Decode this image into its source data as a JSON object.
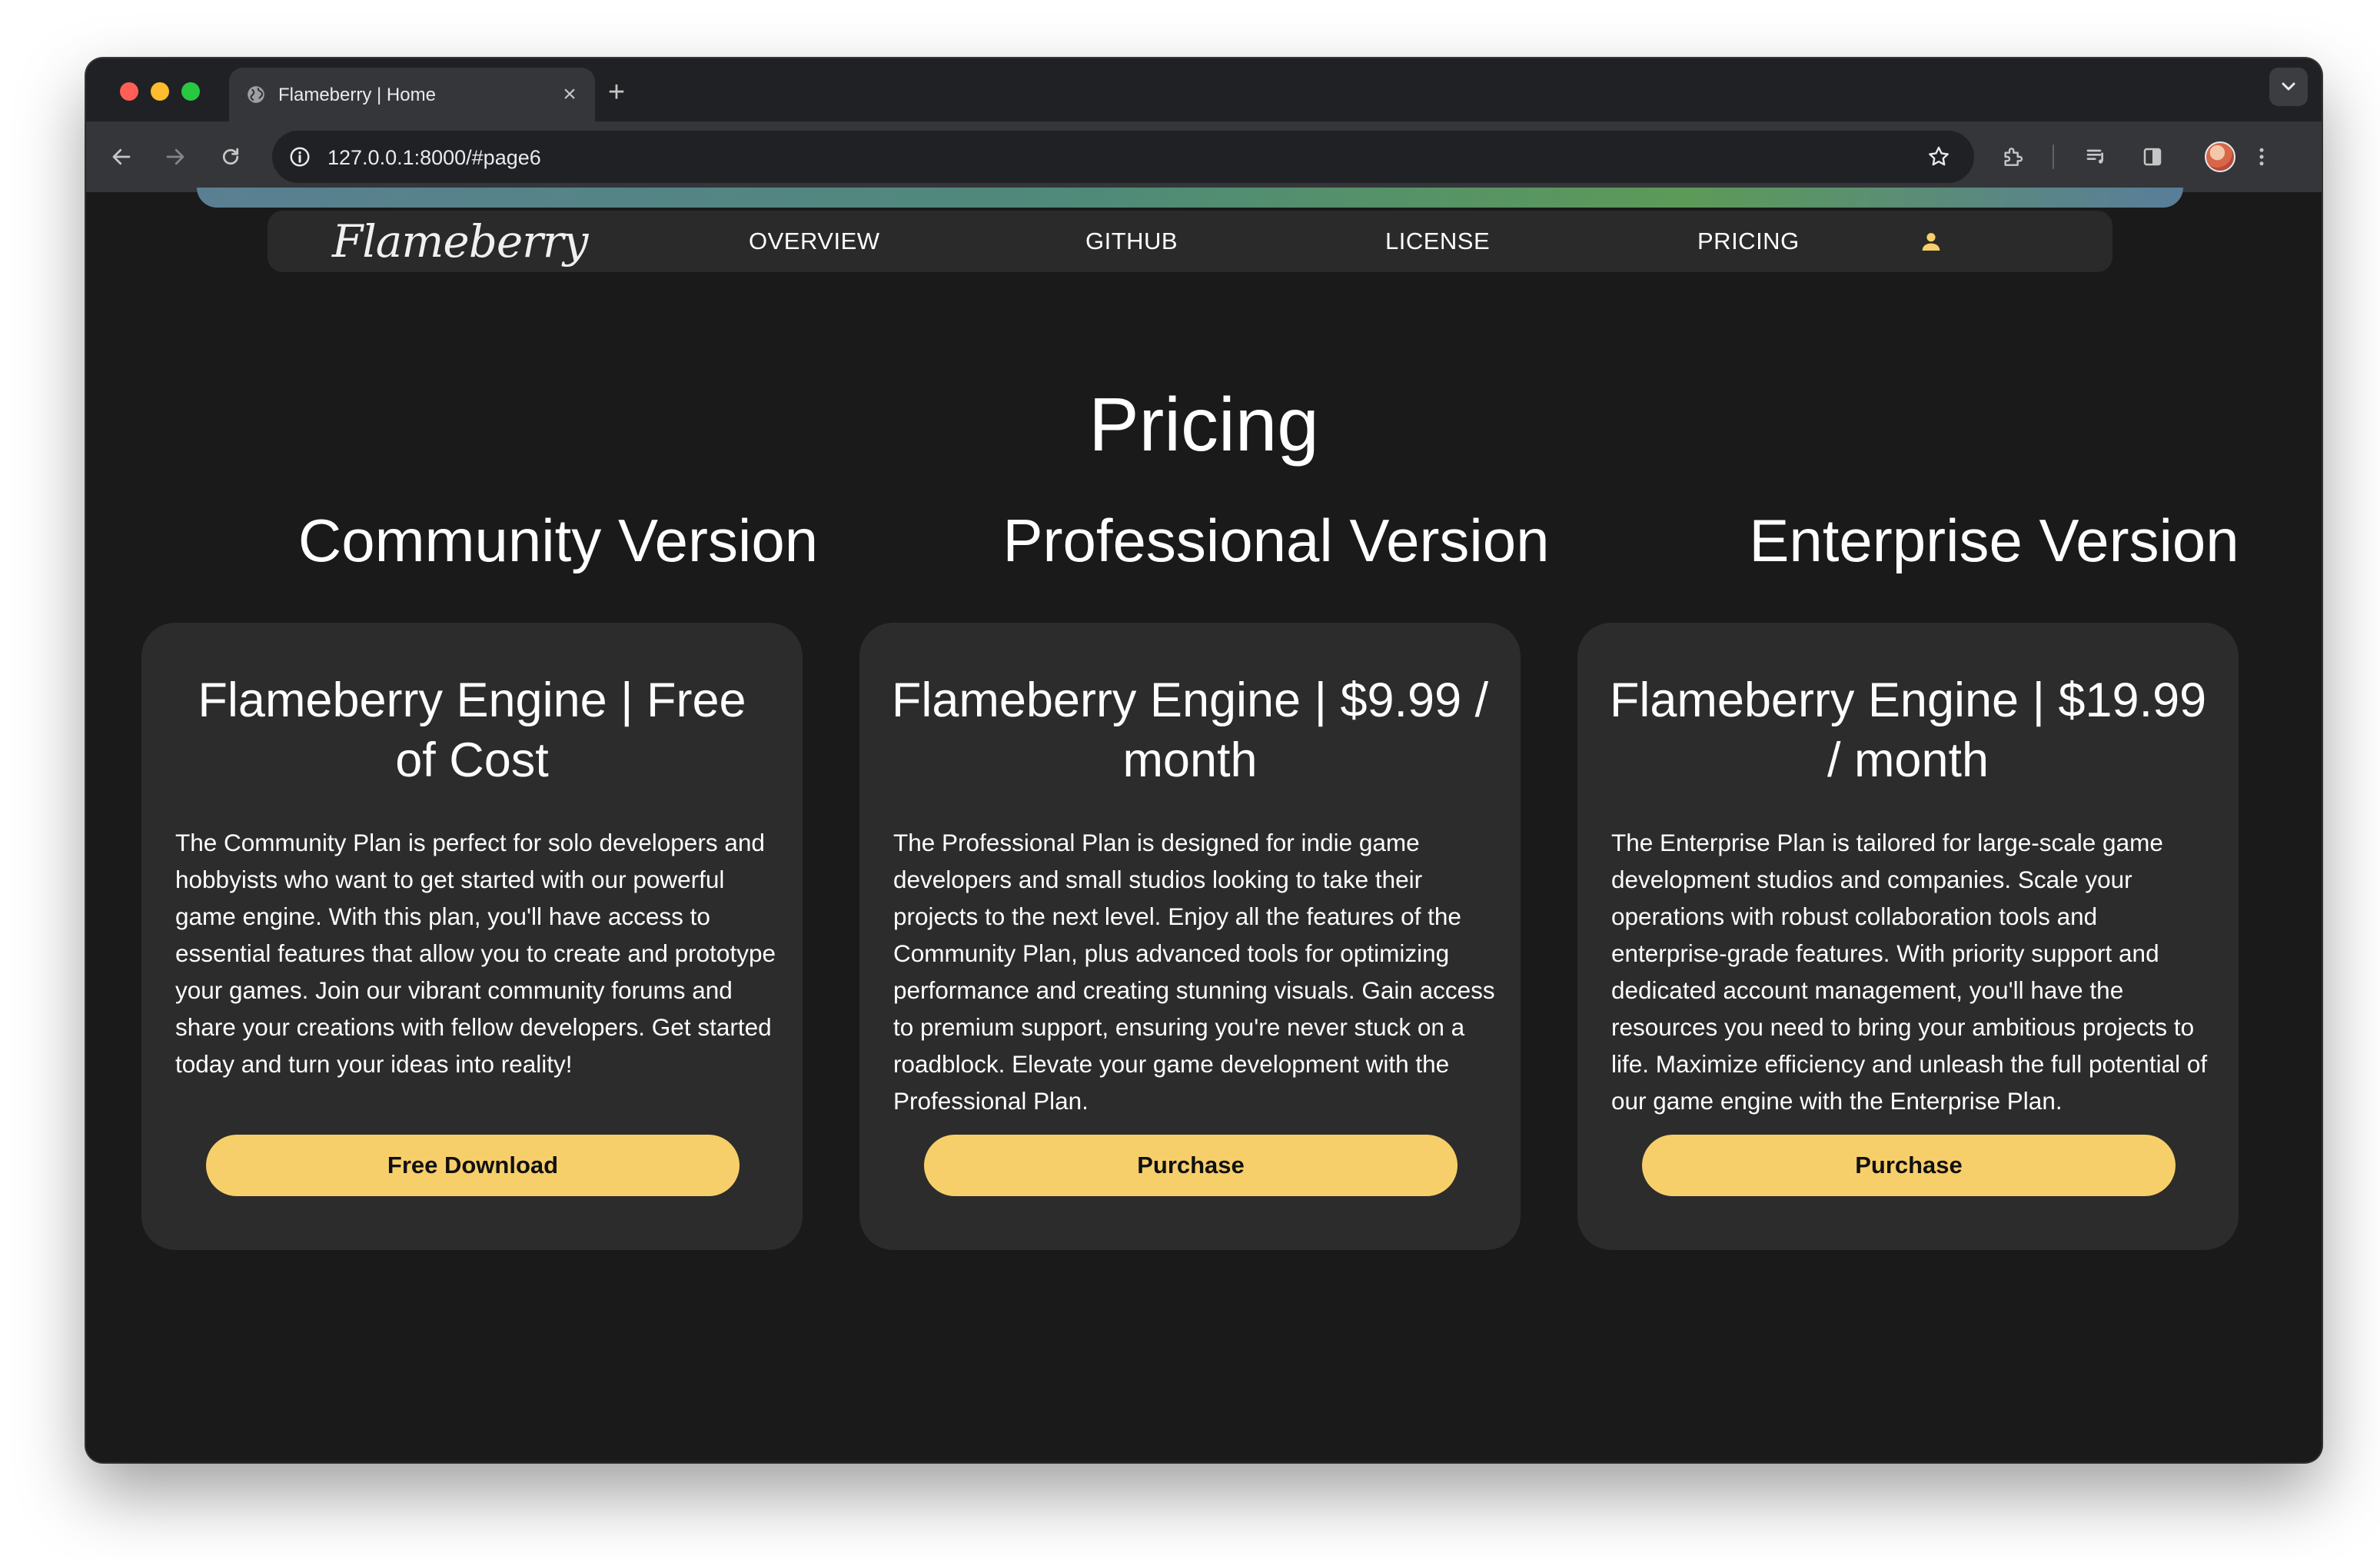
{
  "browser": {
    "tab": {
      "title": "Flameberry | Home",
      "close_glyph": "×"
    },
    "new_tab_glyph": "+",
    "url": "127.0.0.1:8000/#page6",
    "icons": [
      "back-arrow-icon",
      "forward-arrow-icon",
      "reload-icon",
      "site-info-icon",
      "bookmark-star-icon",
      "extensions-icon",
      "media-control-icon",
      "side-panel-icon",
      "profile-avatar",
      "kebab-menu-icon",
      "tab-search-chevron-icon",
      "globe-favicon"
    ]
  },
  "site": {
    "brand": "Flameberry",
    "nav": {
      "overview": "OVERVIEW",
      "github": "GITHUB",
      "license": "LICENSE",
      "pricing": "PRICING"
    },
    "accent_color": "#f7cf6a",
    "background_color": "#1a1a1a",
    "card_color": "#2c2c2c"
  },
  "pricing": {
    "title": "Pricing",
    "plans": [
      {
        "version_title": "Community Version",
        "heading": "Flameberry Engine | Free of Cost",
        "description": "The Community Plan is perfect for solo developers and hobbyists who want to get started with our powerful game engine. With this plan, you'll have access to essential features that allow you to create and prototype your games. Join our vibrant community forums and share your creations with fellow developers. Get started today and turn your ideas into reality!",
        "button": "Free Download"
      },
      {
        "version_title": "Professional Version",
        "heading": "Flameberry Engine | $9.99 / month",
        "description": "The Professional Plan is designed for indie game developers and small studios looking to take their projects to the next level. Enjoy all the features of the Community Plan, plus advanced tools for optimizing performance and creating stunning visuals. Gain access to premium support, ensuring you're never stuck on a roadblock. Elevate your game development with the Professional Plan.",
        "button": "Purchase"
      },
      {
        "version_title": "Enterprise Version",
        "heading": "Flameberry Engine | $19.99 / month",
        "description": "The Enterprise Plan is tailored for large-scale game development studios and companies. Scale your operations with robust collaboration tools and enterprise-grade features. With priority support and dedicated account management, you'll have the resources you need to bring your ambitious projects to life. Maximize efficiency and unleash the full potential of our game engine with the Enterprise Plan.",
        "button": "Purchase"
      }
    ]
  }
}
